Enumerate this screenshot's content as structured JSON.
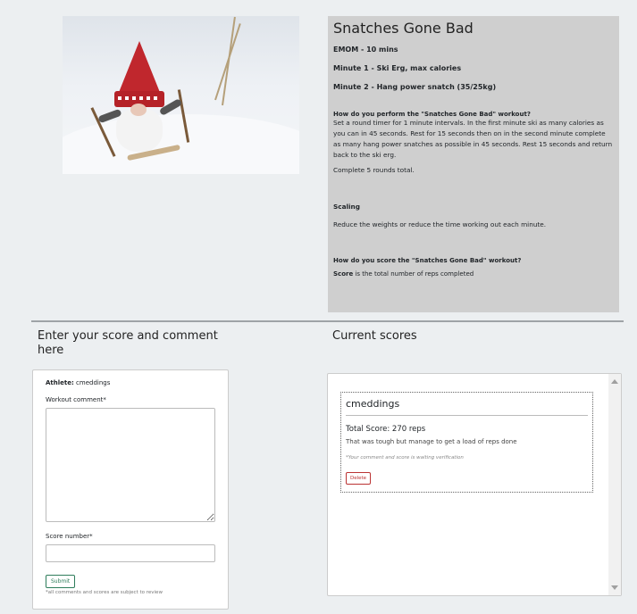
{
  "workout": {
    "title": "Snatches Gone Bad",
    "emom": "EMOM -  10 mins",
    "minute1": "Minute 1 - Ski Erg, max calories",
    "minute2": "Minute 2 - Hang power snatch (35/25kg)",
    "perform_question": "How do you perform the \"Snatches Gone Bad\" workout?",
    "perform_text": "Set a round timer for 1 minute intervals. In the first minute ski as many calories as you can in 45 seconds. Rest for 15 seconds then on in the second minute complete as many hang power snatches as possible in 45 seconds. Rest 15 seconds and return back to the ski erg.",
    "rounds": "Complete 5 rounds total.",
    "scaling_title": "Scaling",
    "scaling_text": "Reduce the weights or reduce the time working out each minute.",
    "score_question": "How do you score the \"Snatches Gone Bad\" workout?",
    "score_label": "Score",
    "score_text": " is the total number of reps completed"
  },
  "form": {
    "heading": "Enter your score and comment here",
    "athlete_label": "Athlete:",
    "athlete_name": " cmeddings",
    "comment_label": "Workout comment*",
    "score_label": "Score number*",
    "submit_label": "Submit",
    "note": "*all comments and scores are subject to review"
  },
  "scores": {
    "heading": "Current scores",
    "entries": [
      {
        "user": "cmeddings",
        "total": "Total Score: 270 reps",
        "comment": "That was tough but manage to get a load of reps done",
        "status": "*Your comment and score is waiting verification",
        "delete_label": "Delete"
      }
    ]
  }
}
